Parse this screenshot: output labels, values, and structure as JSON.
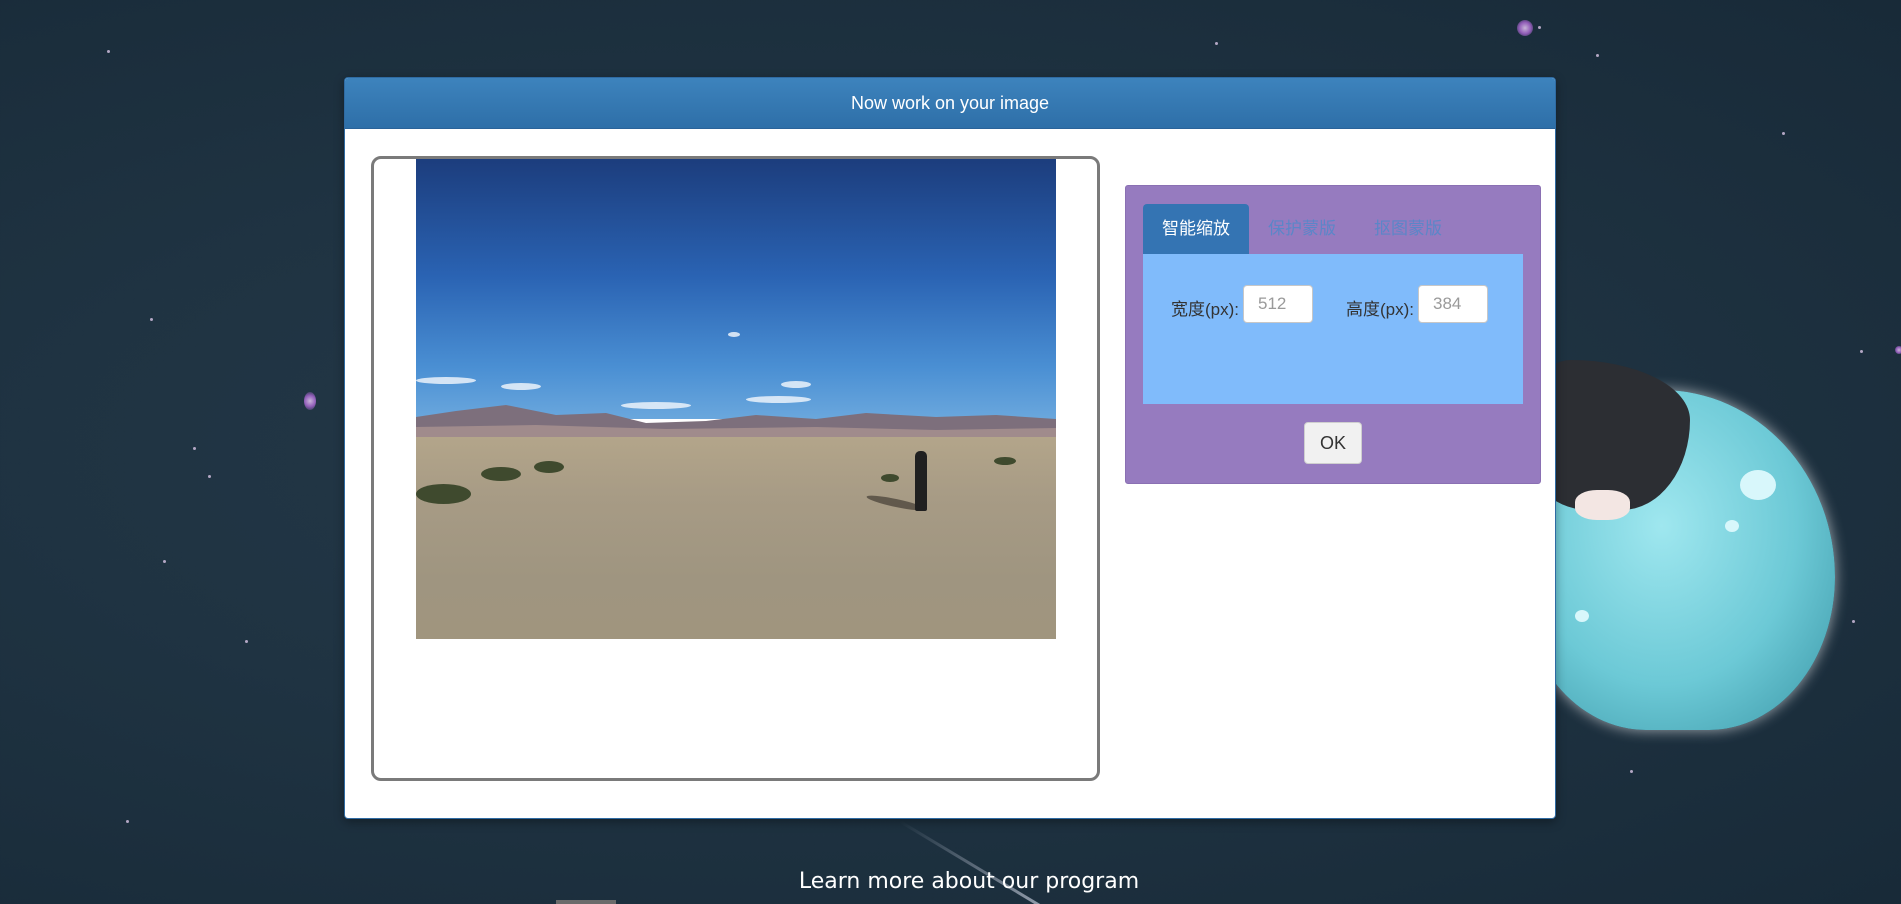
{
  "modal": {
    "title": "Now work on your image"
  },
  "panel": {
    "tabs": [
      {
        "label": "智能缩放",
        "active": true
      },
      {
        "label": "保护蒙版",
        "active": false
      },
      {
        "label": "抠图蒙版",
        "active": false
      }
    ],
    "width": {
      "label": "宽度(px):",
      "placeholder": "512"
    },
    "height": {
      "label": "高度(px):",
      "placeholder": "384"
    },
    "ok_label": "OK"
  },
  "footer": {
    "link_text": "Learn more about our program"
  },
  "colors": {
    "header": "#3474b3",
    "panel": "#967bbf",
    "tab_body": "#80bbfb"
  }
}
